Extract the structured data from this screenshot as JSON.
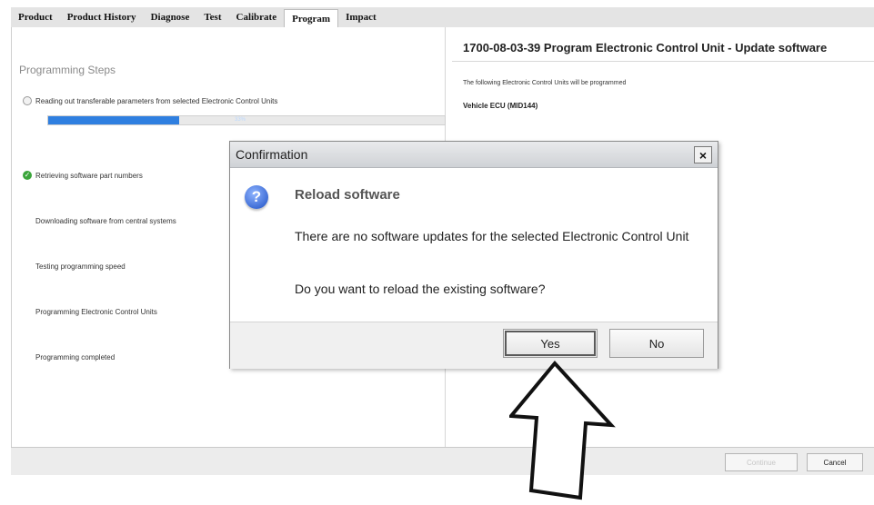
{
  "tabs": [
    {
      "label": "Product"
    },
    {
      "label": "Product History"
    },
    {
      "label": "Diagnose"
    },
    {
      "label": "Test"
    },
    {
      "label": "Calibrate"
    },
    {
      "label": "Program"
    },
    {
      "label": "Impact"
    }
  ],
  "left": {
    "title": "Programming Steps",
    "steps": [
      {
        "label": "Reading out transferable parameters from selected Electronic Control Units"
      },
      {
        "label": "Retrieving software part numbers"
      },
      {
        "label": "Downloading software from central systems"
      },
      {
        "label": "Testing programming speed"
      },
      {
        "label": "Programming Electronic Control Units"
      },
      {
        "label": "Programming completed"
      }
    ],
    "progress": {
      "percent": 33,
      "label": "33%"
    }
  },
  "right": {
    "title": "1700-08-03-39 Program Electronic Control Unit - Update software",
    "subtitle": "The following Electronic Control Units will be programmed",
    "ecu": "Vehicle ECU (MID144)"
  },
  "dialog": {
    "title": "Confirmation",
    "close": "×",
    "icon": "?",
    "heading": "Reload software",
    "message": "There are no software updates for the selected Electronic Control Unit",
    "question": "Do you want to reload the existing software?",
    "yes": "Yes",
    "no": "No"
  },
  "footer": {
    "continue": "Continue",
    "cancel": "Cancel"
  },
  "colors": {
    "progress": "#2f7fe0",
    "success": "#3aa53a"
  }
}
